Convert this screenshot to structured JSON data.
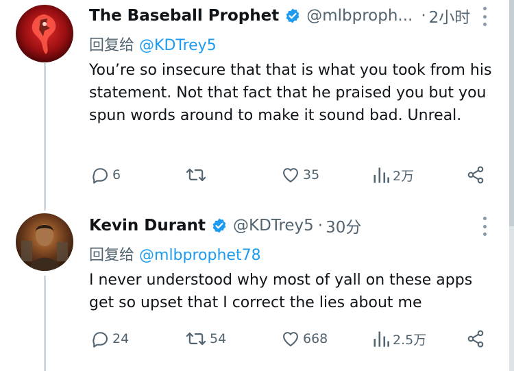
{
  "tweets": [
    {
      "name": "The Baseball Prophet",
      "handle": "@mlbproph...",
      "sep": "·",
      "time": "2小时",
      "reply_prefix": "回复给",
      "reply_handle": "@KDTrey5",
      "text": "You’re so insecure that that is what you took from his statement. Not that fact that he praised you but you spun words around to make it sound bad. Unreal.",
      "replies": "6",
      "retweets": "",
      "likes": "35",
      "views": "2万"
    },
    {
      "name": "Kevin Durant",
      "handle": "@KDTrey5",
      "sep": "·",
      "time": "30分",
      "reply_prefix": "回复给",
      "reply_handle": "@mlbprophet78",
      "text": "I never understood why most of yall on these apps get so upset that I correct the lies about me",
      "replies": "24",
      "retweets": "54",
      "likes": "668",
      "views": "2.5万"
    }
  ],
  "icons": {
    "reply": "comment-bubble-icon",
    "retweet": "retweet-icon",
    "like": "heart-icon",
    "views": "bar-chart-icon",
    "share": "share-icon",
    "verified": "verified-badge-icon",
    "more": "more-vertical-icon"
  },
  "colors": {
    "accent": "#1d9bf0",
    "muted": "#536471",
    "text": "#0f1419"
  }
}
